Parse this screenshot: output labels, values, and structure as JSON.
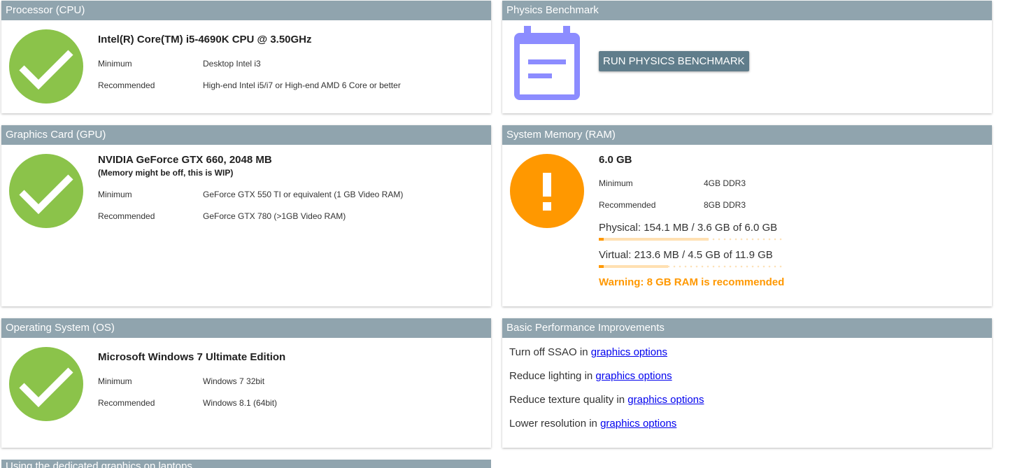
{
  "cpu": {
    "header": "Processor (CPU)",
    "status_color": "#8bc34a",
    "status_icon": "checkmark-icon",
    "name": "Intel(R) Core(TM) i5-4690K CPU @ 3.50GHz",
    "min_label": "Minimum",
    "min_value": "Desktop Intel i3",
    "rec_label": "Recommended",
    "rec_value": "High-end Intel i5/i7 or High-end AMD 6 Core or better"
  },
  "physics": {
    "header": "Physics Benchmark",
    "icon": "calendar-note-icon",
    "icon_color": "#8c8cff",
    "button_label": "RUN PHYSICS BENCHMARK"
  },
  "gpu": {
    "header": "Graphics Card (GPU)",
    "status_color": "#8bc34a",
    "status_icon": "checkmark-icon",
    "name": "NVIDIA GeForce GTX 660, 2048 MB",
    "note": "(Memory might be off, this is WIP)",
    "min_label": "Minimum",
    "min_value": "GeForce GTX 550 TI or equivalent (1 GB Video RAM)",
    "rec_label": "Recommended",
    "rec_value": "GeForce GTX 780 (>1GB Video RAM)"
  },
  "ram": {
    "header": "System Memory (RAM)",
    "status_color": "#ff9800",
    "status_icon": "exclamation-icon",
    "total": "6.0 GB",
    "min_label": "Minimum",
    "min_value": "4GB DDR3",
    "rec_label": "Recommended",
    "rec_value": "8GB DDR3",
    "physical_text": "Physical: 154.1 MB / 3.6 GB of 6.0 GB",
    "physical_used_fraction": 0.0251,
    "physical_buffer_fraction": 0.6,
    "virtual_text": "Virtual: 213.6 MB / 4.5 GB of 11.9 GB",
    "virtual_used_fraction": 0.0175,
    "virtual_buffer_fraction": 0.378,
    "warning": "Warning: 8 GB RAM is recommended",
    "warning_color": "#ff9800"
  },
  "os": {
    "header": "Operating System (OS)",
    "status_color": "#8bc34a",
    "status_icon": "checkmark-icon",
    "name": "Microsoft Windows 7 Ultimate Edition",
    "min_label": "Minimum",
    "min_value": "Windows 7 32bit",
    "rec_label": "Recommended",
    "rec_value": "Windows 8.1 (64bit)"
  },
  "improvements": {
    "header": "Basic Performance Improvements",
    "tips": [
      {
        "text": "Turn off SSAO in ",
        "link": "graphics options"
      },
      {
        "text": "Reduce lighting in ",
        "link": "graphics options"
      },
      {
        "text": "Reduce texture quality in ",
        "link": "graphics options"
      },
      {
        "text": "Lower resolution in ",
        "link": "graphics options"
      }
    ]
  },
  "laptops": {
    "header": "Using the dedicated graphics on laptops"
  },
  "colors": {
    "header_bg": "#90a4ae",
    "button_bg": "#607d8b",
    "link": "#0000ee"
  }
}
